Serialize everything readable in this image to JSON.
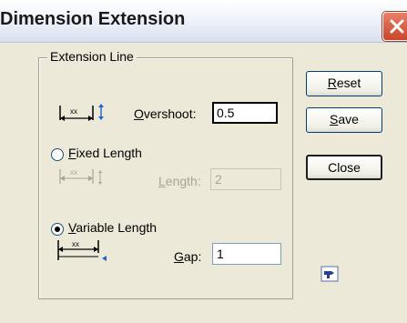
{
  "window": {
    "title": "Dimension Extension"
  },
  "group": {
    "legend": "Extension Line"
  },
  "overshoot": {
    "label_prefix": "",
    "label_accel": "O",
    "label_rest": "vershoot:",
    "value": "0.5"
  },
  "fixed": {
    "label_accel": "F",
    "label_rest": "ixed Length",
    "checked": false
  },
  "length": {
    "label_accel": "L",
    "label_rest": "ength:",
    "value": "2"
  },
  "variable": {
    "label_accel": "V",
    "label_rest": "ariable Length",
    "checked": true
  },
  "gap": {
    "label_accel": "G",
    "label_rest": "ap:",
    "value": "1"
  },
  "buttons": {
    "reset": {
      "accel": "R",
      "rest": "eset"
    },
    "save": {
      "accel": "S",
      "rest": "ave"
    },
    "close": {
      "label": "Close"
    }
  },
  "icons": {
    "overshoot": "overshoot-dimension-icon",
    "fixed": "fixed-length-dimension-icon",
    "variable": "variable-length-dimension-icon",
    "help": "help-pointer-icon",
    "close": "close-x-icon"
  },
  "colors": {
    "accent": "#1e64d2",
    "close": "#d0553a"
  }
}
